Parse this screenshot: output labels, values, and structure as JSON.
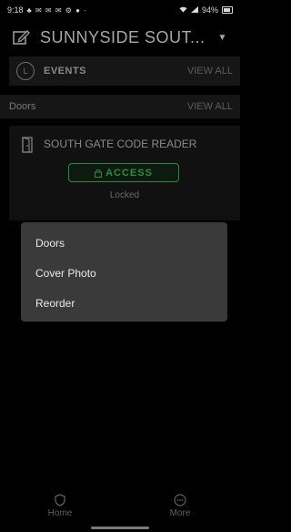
{
  "status_bar": {
    "time": "9:18",
    "battery": "94%"
  },
  "header": {
    "title": "SUNNYSIDE SOUT..."
  },
  "events": {
    "label": "EVENTS",
    "view_all": "VIEW ALL"
  },
  "doors_section": {
    "label": "Doors",
    "view_all": "VIEW ALL"
  },
  "door": {
    "name": "SOUTH GATE CODE READER",
    "access_label": "ACCESS",
    "state": "Locked"
  },
  "menu": {
    "items": [
      "Doors",
      "Cover Photo",
      "Reorder"
    ]
  },
  "nav": {
    "home": "Home",
    "more": "More"
  },
  "colors": {
    "accent_green": "#2f8d3d",
    "menu_bg": "#3a3a3a"
  }
}
